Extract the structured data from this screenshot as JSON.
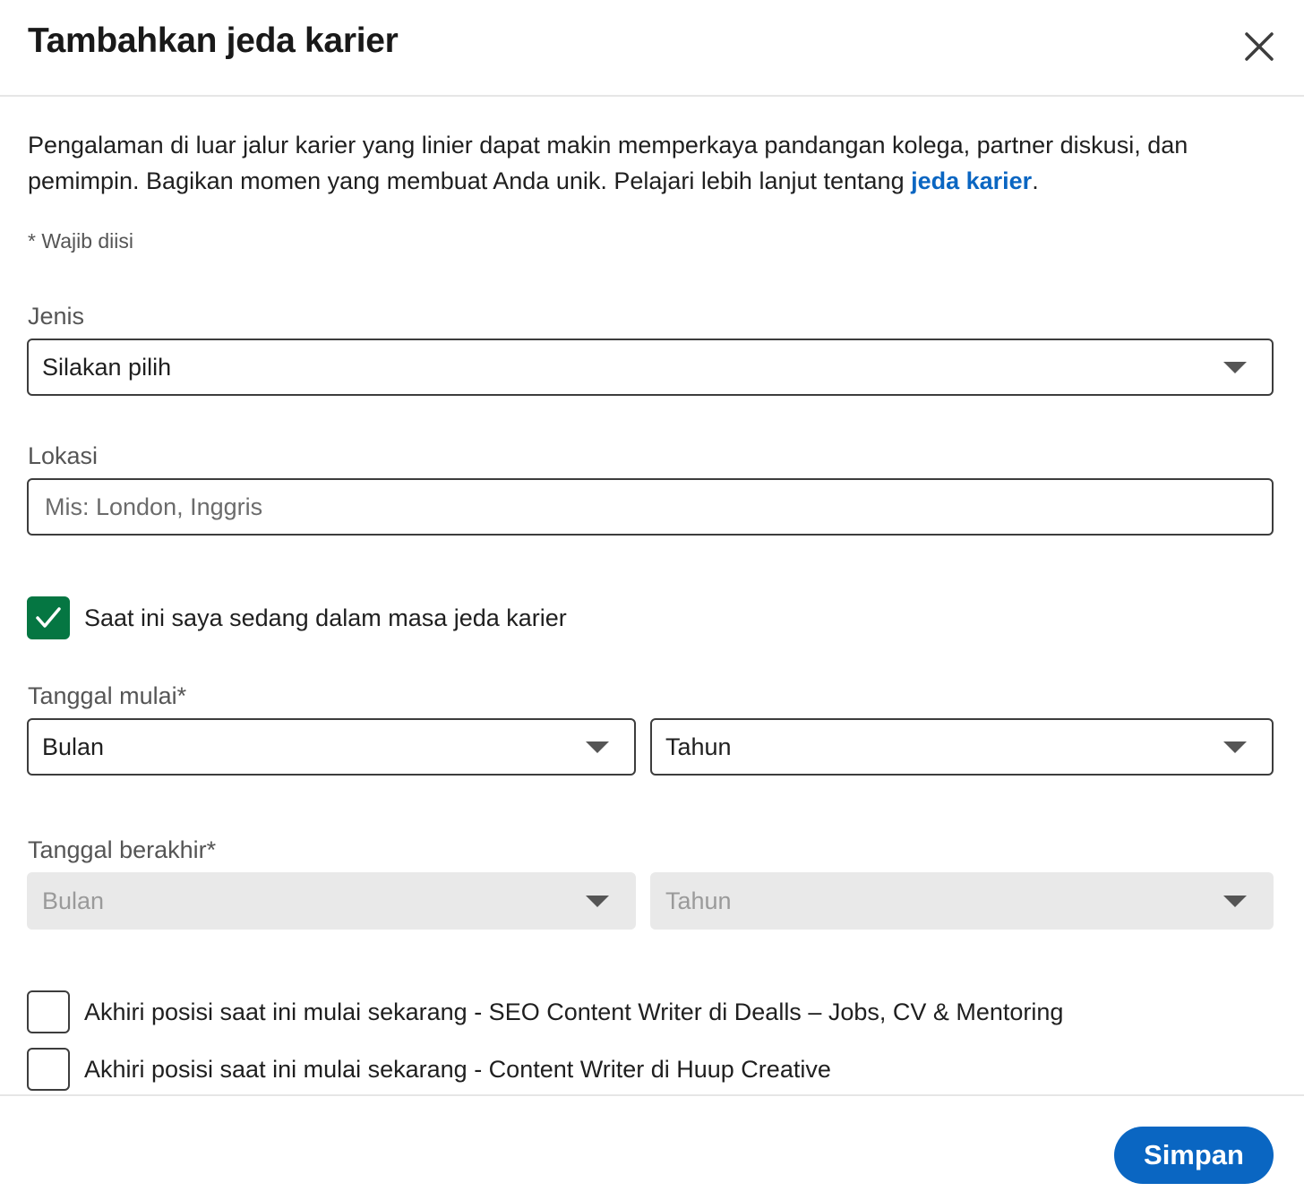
{
  "dialog": {
    "title": "Tambahkan jeda karier",
    "close_icon": "close-icon"
  },
  "intro": {
    "text": "Pengalaman di luar jalur karier yang linier dapat makin memperkaya pandangan kolega, partner diskusi, dan pemimpin. Bagikan momen yang membuat Anda unik. Pelajari lebih lanjut tentang ",
    "link_text": "jeda karier",
    "suffix": "."
  },
  "required_note": "* Wajib diisi",
  "type_field": {
    "label": "Jenis",
    "value": "Silakan pilih"
  },
  "location_field": {
    "label": "Lokasi",
    "placeholder": "Mis: London, Inggris",
    "value": ""
  },
  "current_break": {
    "label": "Saat ini saya sedang dalam masa jeda karier",
    "checked": true
  },
  "start_date": {
    "label": "Tanggal mulai*",
    "month": "Bulan",
    "year": "Tahun"
  },
  "end_date": {
    "label": "Tanggal berakhir*",
    "month": "Bulan",
    "year": "Tahun",
    "disabled": true
  },
  "end_positions": [
    {
      "label": "Akhiri posisi saat ini mulai sekarang - SEO Content Writer di Dealls – Jobs, CV & Mentoring",
      "checked": false
    },
    {
      "label": "Akhiri posisi saat ini mulai sekarang - Content Writer di Huup Creative",
      "checked": false
    }
  ],
  "footer": {
    "save_label": "Simpan"
  },
  "colors": {
    "primary": "#0a66c2",
    "checkbox_checked": "#057642",
    "disabled_bg": "#e9e9e9"
  }
}
